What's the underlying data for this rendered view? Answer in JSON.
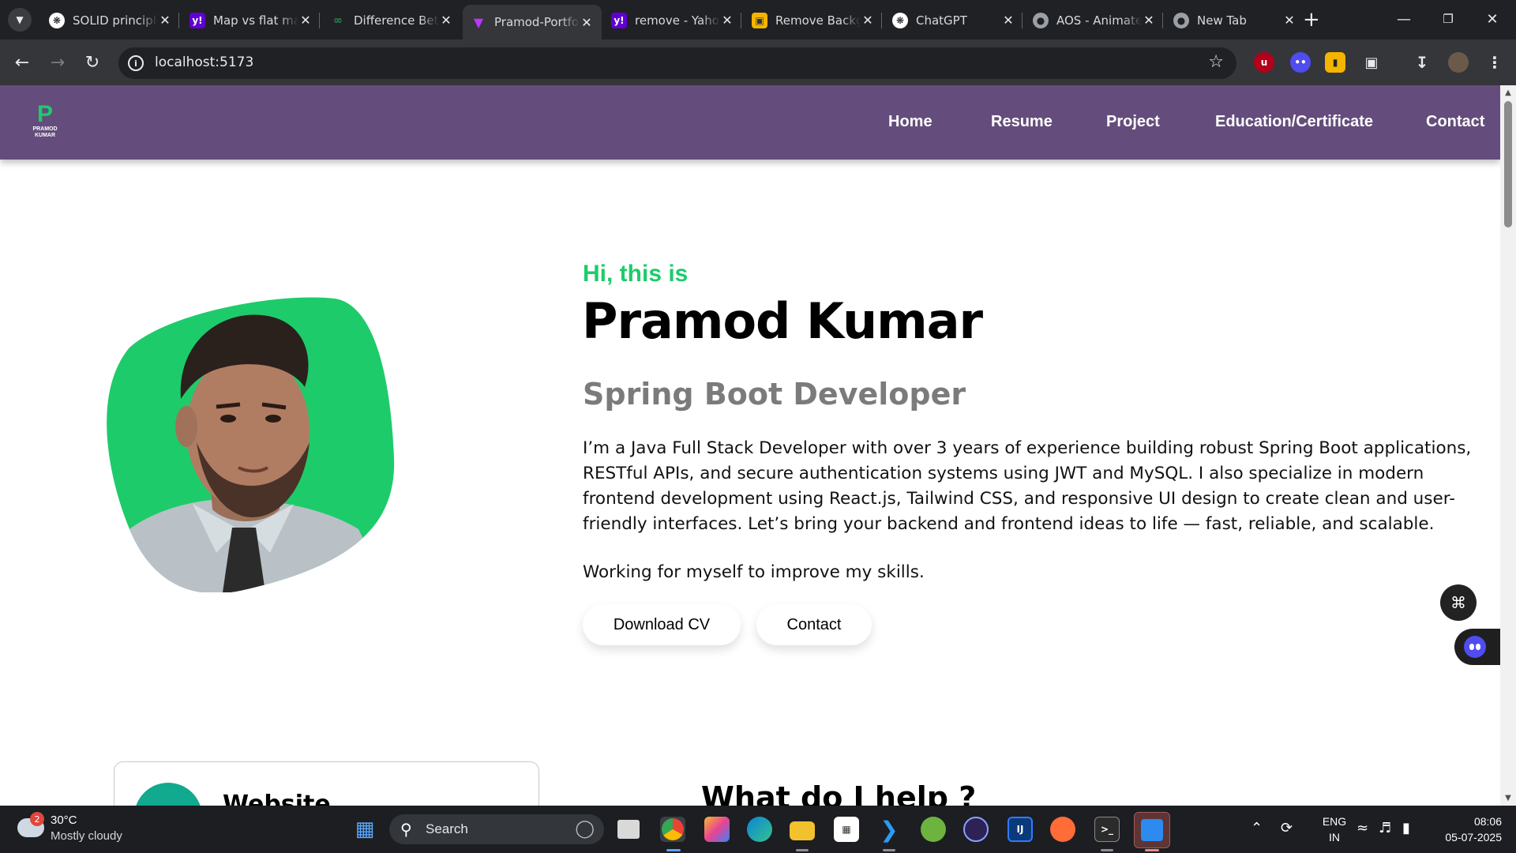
{
  "browser": {
    "tabs": [
      {
        "title": "SOLID principles",
        "icon": "chatgpt-icon",
        "color": "#ffffff"
      },
      {
        "title": "Map vs flat map",
        "icon": "yahoo-icon",
        "color": "#6001d2"
      },
      {
        "title": "Difference Between",
        "icon": "geeksforgeeks-icon",
        "color": "#2f8d46"
      },
      {
        "title": "Pramod-Portfolio",
        "icon": "vite-icon",
        "color": "#bd34fe",
        "active": true
      },
      {
        "title": "remove - Yahoo",
        "icon": "yahoo-icon",
        "color": "#6001d2"
      },
      {
        "title": "Remove Background",
        "icon": "removebg-icon",
        "color": "#f4b400"
      },
      {
        "title": "ChatGPT",
        "icon": "chatgpt-icon",
        "color": "#ffffff"
      },
      {
        "title": "AOS - Animate",
        "icon": "globe-icon",
        "color": "#9aa0a6"
      },
      {
        "title": "New Tab",
        "icon": "globe-icon",
        "color": "#9aa0a6"
      }
    ],
    "url": "localhost:5173"
  },
  "site": {
    "logo": {
      "letter": "P",
      "line1": "PRAMOD",
      "line2": "KUMAR"
    },
    "nav": [
      "Home",
      "Resume",
      "Project",
      "Education/Certificate",
      "Contact"
    ],
    "colors": {
      "nav_bg": "#644d7c",
      "accent": "#1ecb6b",
      "role": "#7b7b7b"
    }
  },
  "hero": {
    "greeting": "Hi, this is",
    "name": "Pramod Kumar",
    "role": "Spring Boot Developer",
    "bio": "I’m a Java Full Stack Developer with over 3 years of experience building robust Spring Boot applications, RESTful APIs, and secure authentication systems using JWT and MySQL. I also specialize in modern frontend development using React.js, Tailwind CSS, and responsive UI design to create clean and user-friendly interfaces. Let’s bring your backend and frontend ideas to life — fast, reliable, and scalable.",
    "note": "Working for myself to improve my skills.",
    "buttons": {
      "download": "Download CV",
      "contact": "Contact"
    }
  },
  "services": {
    "card_title": "Website",
    "section_title": "What do I help ?"
  },
  "taskbar": {
    "weather": {
      "temp": "30°C",
      "desc": "Mostly cloudy",
      "badge": "2"
    },
    "search": "Search",
    "lang": {
      "line1": "ENG",
      "line2": "IN"
    },
    "clock": {
      "time": "08:06",
      "date": "05-07-2025"
    }
  }
}
